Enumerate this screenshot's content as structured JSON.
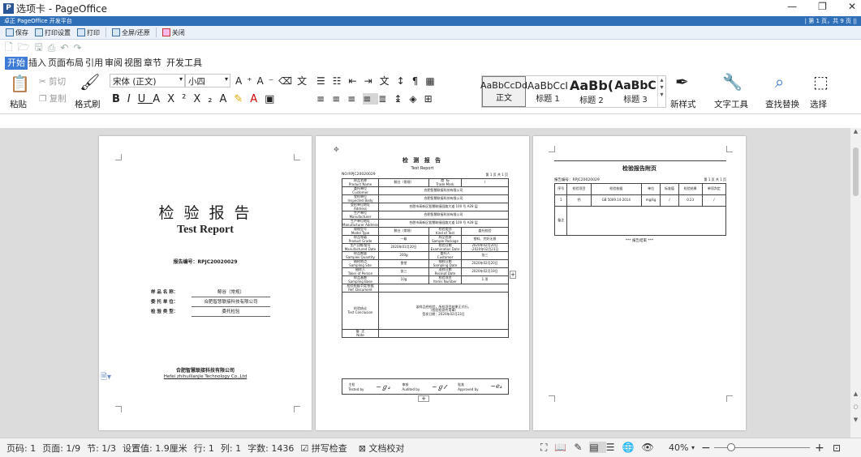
{
  "window": {
    "title": "选项卡 - PageOffice",
    "minimize": "—",
    "restore": "❐",
    "close": "✕"
  },
  "po_bar": {
    "left": "卓正 PageOffice 开发平台",
    "right": "| 第 1 页，共 9 页 ||"
  },
  "po_toolbar": [
    {
      "label": "保存"
    },
    {
      "label": "打印设置"
    },
    {
      "label": "打印"
    },
    {
      "label": "全屏/还原"
    },
    {
      "label": "关闭"
    }
  ],
  "menu_tabs": [
    "开始",
    "插入",
    "页面布局",
    "引用",
    "审阅",
    "视图",
    "章节",
    "开发工具"
  ],
  "ribbon": {
    "paste": "粘贴",
    "cut": "剪切",
    "copy": "复制",
    "format_painter": "格式刷",
    "font_name": "宋体 (正文)",
    "font_size": "小四",
    "styles": [
      {
        "preview": "AaBbCcDd",
        "name": "正文"
      },
      {
        "preview": "AaBbCcI",
        "name": "标题 1"
      },
      {
        "preview": "AaBb(",
        "name": "标题 2"
      },
      {
        "preview": "AaBbC",
        "name": "标题 3"
      }
    ],
    "new_style": "新样式",
    "text_tools": "文字工具",
    "find_replace": "查找替换",
    "select": "选择"
  },
  "page1": {
    "title_cn": "检 验 报 告",
    "title_en": "Test Report",
    "report_no": "报告编号：RPJC20020029",
    "rows": [
      {
        "label": "样 品 名 称：",
        "value": "鲸谷（常规）"
      },
      {
        "label": "委 托 单 位：",
        "value": "合肥智慧联接科技有限公司"
      },
      {
        "label": "检 验 类 型：",
        "value": "委托检验"
      }
    ],
    "company_cn": "合肥智慧联接科技有限公司",
    "company_en": "Hefei zhihuilianjie Technology Co.,Ltd"
  },
  "page2": {
    "title_cn": "检 测 报 告",
    "title_en": "Test  Report",
    "no": "NO:RPJC20020029",
    "page_no": "第 1 页 共 1 页",
    "rows": [
      [
        "样品名称\nProduct Name",
        "鲸谷（常规）",
        "商  标\nTrade Mark",
        "/"
      ],
      [
        "委托单位\nCustomer",
        "合肥智慧联接科技有限公司",
        "",
        ""
      ],
      [
        "受检单位\nInspected Body",
        "合肥智慧联接科技有限公司",
        "",
        ""
      ],
      [
        "受检单位地址\nAddress",
        "合肥市高新区智慧联接园路大道 100 号 A28 层",
        "",
        ""
      ],
      [
        "生产单位\nManufacturer",
        "合肥智慧联接科技有限公司",
        "",
        ""
      ],
      [
        "生产单位地址\nManufacturer Address",
        "合肥市高新区智慧联接园路大道 100 号 A28 层",
        "",
        ""
      ],
      [
        "规格型号\nModel Type",
        "鲸谷（常规）",
        "检验类别\nKind of Test",
        "委托检验"
      ],
      [
        "样品等级\nProduct Grade",
        "一级",
        "样品包装\nSample Package",
        "塑料、完好无损"
      ],
      [
        "生产日期/批号\nManufactured Date",
        "2020年01月20日",
        "检验日期\nExamination Date",
        "2020年02月20日\n-2020年02月23日"
      ],
      [
        "样品数量\nSamples Quantity",
        "200g",
        "委托人\nCustomer",
        "张三"
      ],
      [
        "抽样地点\nSampling Site",
        "食堂",
        "抽样日期\nSampling Date",
        "2020年02月20日"
      ],
      [
        "抽样人\nTaker of Person",
        "张三",
        "送样日期\nReceipt Date",
        "2020年02月19日"
      ],
      [
        "样品基数\nSampling Base",
        "10g",
        "检验项目\nItems Number",
        "1 项"
      ],
      [
        "检验依据/判定依据\nRef. Document",
        "",
        "",
        ""
      ],
      [
        "检验结论\nTest Conclusion",
        "该样品经检验，所检项目结果正式行。\n（检验检测专用章）\n签发日期：2020年02月23日",
        "",
        ""
      ],
      [
        "备  注\nNote",
        "",
        "",
        ""
      ]
    ],
    "sign": [
      {
        "label": "主检\nTested by"
      },
      {
        "label": "审核\nAudited by"
      },
      {
        "label": "批准\nApproved by"
      }
    ]
  },
  "page3": {
    "title": "检验报告附页",
    "report_no": "报告编号：RPJC20020029",
    "page": "第 1 页 共 1 页",
    "headers": [
      "序号",
      "检验项目",
      "检验依据",
      "单位",
      "标准值",
      "检验结果",
      "单项判定"
    ],
    "row": [
      "1",
      "钙",
      "GB 5009.14-2014",
      "mg/kg",
      "/",
      "0.23",
      "/"
    ],
    "remark": "备注",
    "end": "*** 报告结束 ***"
  },
  "statusbar": {
    "page": "页码: 1",
    "pages": "页面: 1/9",
    "section": "节: 1/3",
    "setting": "设置值: 1.9厘米",
    "row": "行: 1",
    "col": "列: 1",
    "words": "字数: 1436",
    "spell": "拼写检查",
    "proof": "文档校对",
    "zoom": "40%"
  }
}
